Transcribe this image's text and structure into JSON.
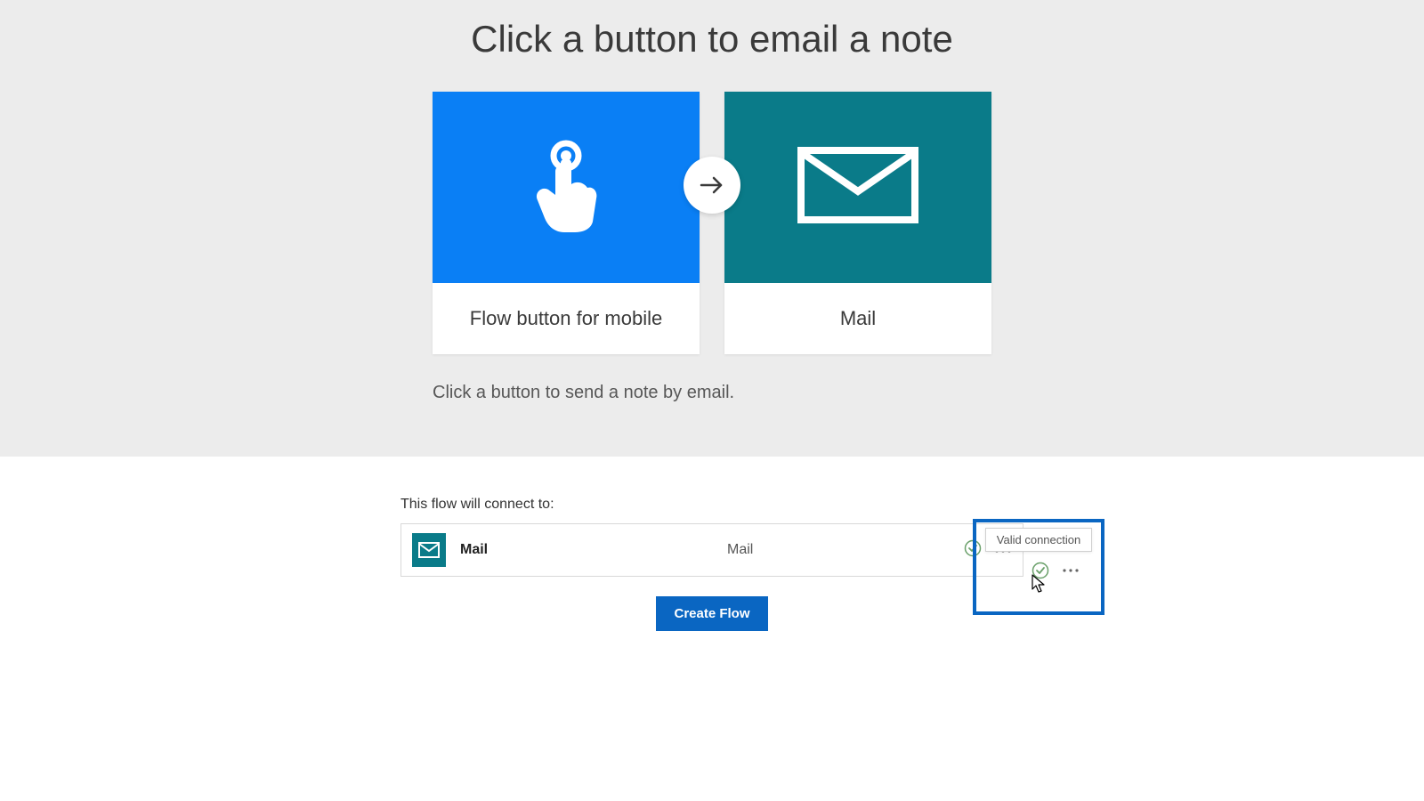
{
  "header": {
    "title": "Click a button to email a note"
  },
  "tiles": {
    "left_label": "Flow button for mobile",
    "right_label": "Mail"
  },
  "description": "Click a button to send a note by email.",
  "connect": {
    "intro": "This flow will connect to:",
    "service_name": "Mail",
    "service_type": "Mail",
    "tooltip": "Valid connection"
  },
  "actions": {
    "create_flow": "Create Flow"
  },
  "colors": {
    "tile_blue": "#0a7ff5",
    "tile_teal": "#0a7b89",
    "primary_button": "#0a66c2"
  }
}
